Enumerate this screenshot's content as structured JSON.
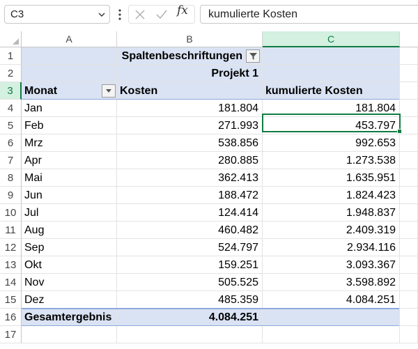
{
  "formula_bar": {
    "name_box": "C3",
    "fx_label": "fx",
    "formula": "kumulierte Kosten"
  },
  "columns": [
    "A",
    "B",
    "C"
  ],
  "pivot": {
    "col_labels_header": "Spaltenbeschriftungen",
    "project_header": "Projekt 1",
    "header_row": {
      "monat": "Monat",
      "kosten": "Kosten",
      "kumuliert": "kumulierte Kosten"
    },
    "rows": [
      {
        "monat": "Jan",
        "kosten": "181.804",
        "kumuliert": "181.804"
      },
      {
        "monat": "Feb",
        "kosten": "271.993",
        "kumuliert": "453.797"
      },
      {
        "monat": "Mrz",
        "kosten": "538.856",
        "kumuliert": "992.653"
      },
      {
        "monat": "Apr",
        "kosten": "280.885",
        "kumuliert": "1.273.538"
      },
      {
        "monat": "Mai",
        "kosten": "362.413",
        "kumuliert": "1.635.951"
      },
      {
        "monat": "Jun",
        "kosten": "188.472",
        "kumuliert": "1.824.423"
      },
      {
        "monat": "Jul",
        "kosten": "124.414",
        "kumuliert": "1.948.837"
      },
      {
        "monat": "Aug",
        "kosten": "460.482",
        "kumuliert": "2.409.319"
      },
      {
        "monat": "Sep",
        "kosten": "524.797",
        "kumuliert": "2.934.116"
      },
      {
        "monat": "Okt",
        "kosten": "159.251",
        "kumuliert": "3.093.367"
      },
      {
        "monat": "Nov",
        "kosten": "505.525",
        "kumuliert": "3.598.892"
      },
      {
        "monat": "Dez",
        "kosten": "485.359",
        "kumuliert": "4.084.251"
      }
    ],
    "total": {
      "label": "Gesamtergebnis",
      "kosten": "4.084.251"
    }
  },
  "row_numbers": [
    "1",
    "2",
    "3",
    "4",
    "5",
    "6",
    "7",
    "8",
    "9",
    "10",
    "11",
    "12",
    "13",
    "14",
    "15",
    "16",
    "17"
  ],
  "colors": {
    "pivot_blue": "#dae3f3",
    "excel_green": "#107c41"
  }
}
